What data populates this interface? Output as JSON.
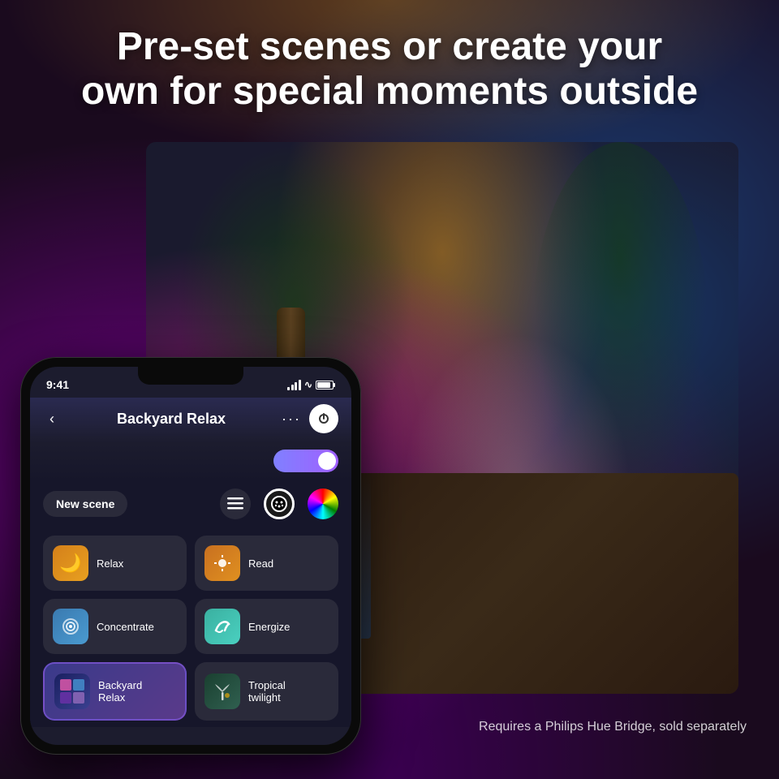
{
  "background": {
    "gradient": "radial"
  },
  "header": {
    "title_line1": "Pre-set scenes or create your",
    "title_line2": "own for special moments outside"
  },
  "phone": {
    "status_bar": {
      "time": "9:41",
      "signal": "●●●",
      "wifi": "wifi",
      "battery": "battery"
    },
    "nav": {
      "back_icon": "chevron-left",
      "title": "Backyard Relax",
      "dots_icon": "more",
      "power_icon": "power"
    },
    "toolbar": {
      "new_scene": "New scene",
      "list_icon": "list",
      "palette_icon": "palette",
      "color_icon": "color-wheel"
    },
    "scenes": [
      {
        "id": "relax",
        "label": "Relax",
        "icon": "🌙",
        "color": "orange",
        "active": false
      },
      {
        "id": "read",
        "label": "Read",
        "icon": "☀",
        "color": "amber",
        "active": false
      },
      {
        "id": "concentrate",
        "label": "Concentrate",
        "icon": "◎",
        "color": "blue",
        "active": false
      },
      {
        "id": "energize",
        "label": "Energize",
        "icon": "🌊",
        "color": "teal",
        "active": false
      },
      {
        "id": "backyard",
        "label": "Backyard\nRelax",
        "icon": "🏕",
        "color": "dark-blue",
        "active": true
      },
      {
        "id": "tropical",
        "label": "Tropical\ntwilight",
        "icon": "🌴",
        "color": "dark-green",
        "active": false
      }
    ]
  },
  "footer": {
    "note": "Requires a Philips Hue Bridge, sold separately"
  },
  "tropical_label": "Tropical twilight"
}
